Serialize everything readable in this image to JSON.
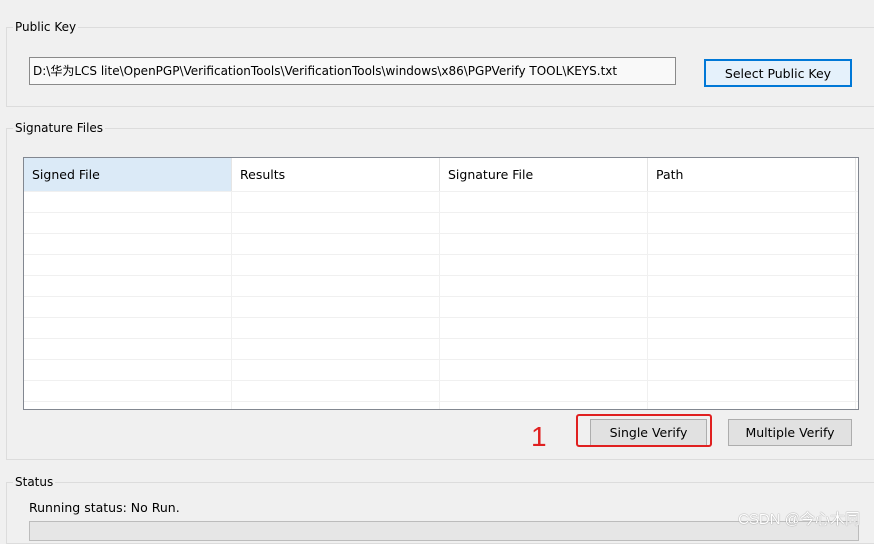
{
  "public_key": {
    "title": "Public Key",
    "path_value": "D:\\华为LCS lite\\OpenPGP\\VerificationTools\\VerificationTools\\windows\\x86\\PGPVerify TOOL\\KEYS.txt",
    "select_button": "Select Public Key"
  },
  "signature_files": {
    "title": "Signature Files",
    "columns": [
      "Signed File",
      "Results",
      "Signature File",
      "Path"
    ],
    "single_verify_button": "Single Verify",
    "multiple_verify_button": "Multiple Verify"
  },
  "annotation": {
    "step_number": "1",
    "highlight_color": "#e02020"
  },
  "status": {
    "title": "Status",
    "running_status": "Running status: No Run.",
    "progress": 0
  },
  "watermark": "CSDN @今心木同",
  "colors": {
    "accent": "#0078d7",
    "header_selected": "#dbeaf7"
  }
}
